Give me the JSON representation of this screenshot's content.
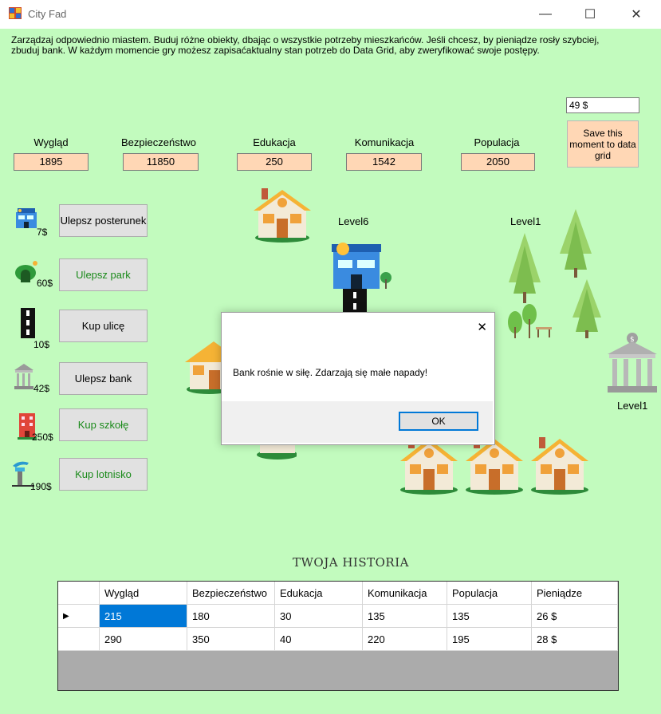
{
  "window": {
    "title": "City Fad",
    "minimize": "—",
    "maximize": "☐",
    "close": "✕"
  },
  "intro_text": "Zarządzaj odpowiednio miastem. Buduj różne obiekty, dbając o wszystkie potrzeby mieszkańców. Jeśli chcesz, by pieniądze rosły szybciej, zbuduj bank. W każdym momencie gry możesz zapisaćaktualny stan potrzeb do Data Grid, aby zweryfikować swoje postępy.",
  "money": "49 $",
  "save_button": "Save this moment to data grid",
  "stats": [
    {
      "label": "Wygląd",
      "value": "1895"
    },
    {
      "label": "Bezpieczeństwo",
      "value": "11850"
    },
    {
      "label": "Edukacja",
      "value": "250"
    },
    {
      "label": "Komunikacja",
      "value": "1542"
    },
    {
      "label": "Populacja",
      "value": "2050"
    }
  ],
  "actions": [
    {
      "label": "Ulepsz posterunek",
      "price": "7$",
      "icon": "police-station-icon",
      "enabled": true
    },
    {
      "label": "Ulepsz park",
      "price": "60$",
      "icon": "park-icon",
      "enabled": false
    },
    {
      "label": "Kup ulicę",
      "price": "10$",
      "icon": "road-icon",
      "enabled": true
    },
    {
      "label": "Ulepsz bank",
      "price": "42$",
      "icon": "bank-icon",
      "enabled": true
    },
    {
      "label": "Kup szkołę",
      "price": "250$",
      "icon": "school-icon",
      "enabled": false
    },
    {
      "label": "Kup lotnisko",
      "price": "190$",
      "icon": "airport-icon",
      "enabled": false
    }
  ],
  "levels": {
    "police": "Level6",
    "park": "Level1",
    "bank": "Level1"
  },
  "history_title": "TWOJA HISTORIA",
  "grid": {
    "columns": [
      "Wygląd",
      "Bezpieczeństwo",
      "Edukacja",
      "Komunikacja",
      "Populacja",
      "Pieniądze"
    ],
    "rows": [
      [
        "215",
        "180",
        "30",
        "135",
        "135",
        "26 $"
      ],
      [
        "290",
        "350",
        "40",
        "220",
        "195",
        "28 $"
      ]
    ],
    "current_row_marker": "▶"
  },
  "dialog": {
    "message": "Bank rośnie w siłę. Zdarzają się małe napady!",
    "ok": "OK",
    "close": "✕"
  },
  "colors": {
    "background": "#c2fbbe",
    "stat_box": "#ffd7b5",
    "selection": "#0078d7",
    "disabled_text": "#1a8a1a",
    "house_roof": "#f5b335"
  }
}
